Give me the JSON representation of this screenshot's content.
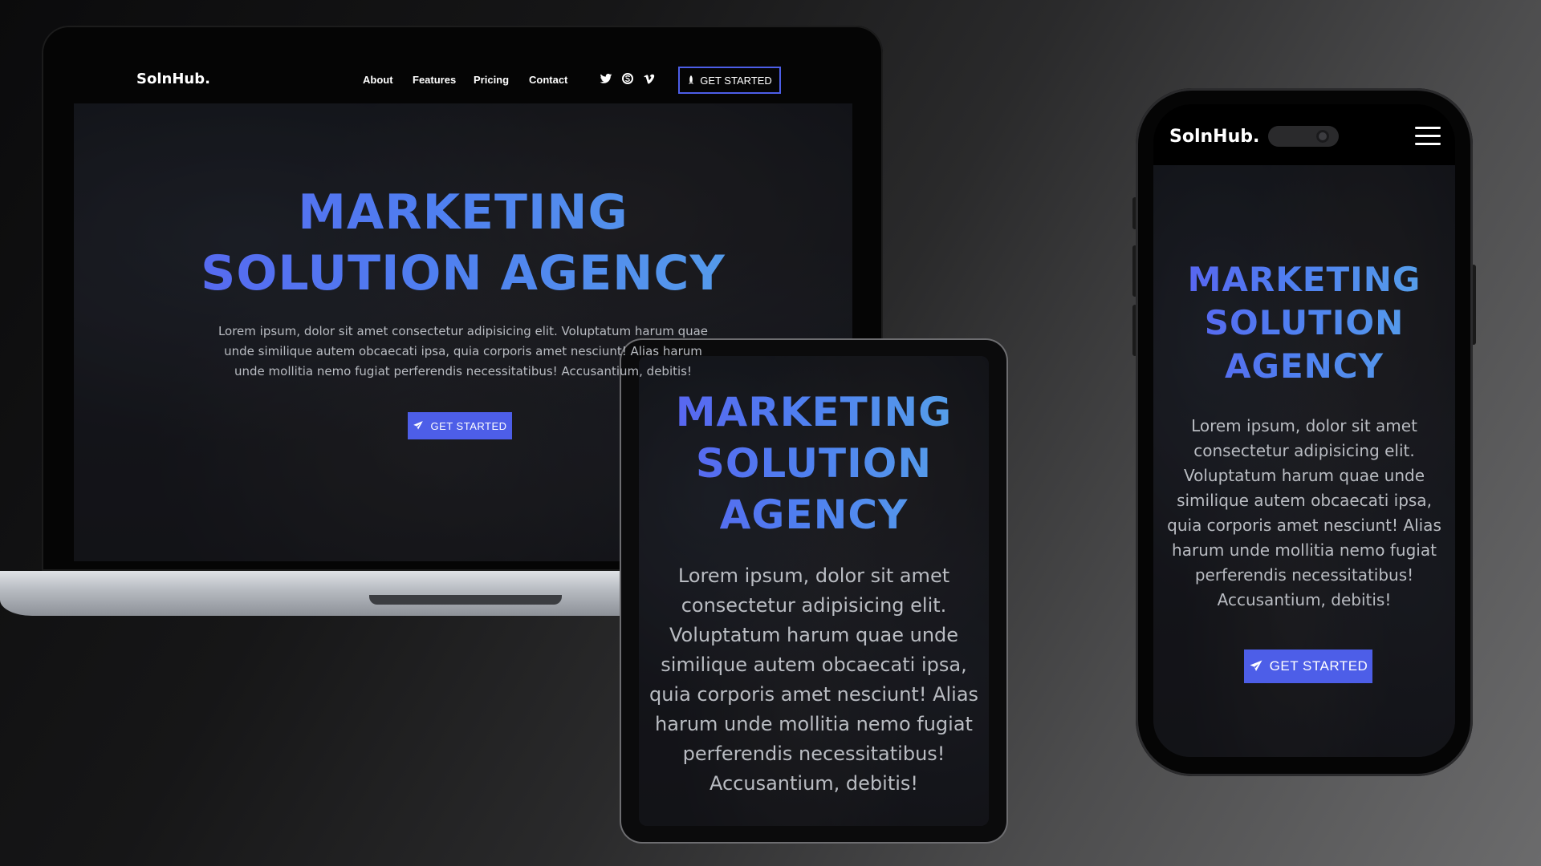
{
  "brand": "SolnHub.",
  "nav": {
    "links": [
      "About",
      "Features",
      "Pricing",
      "Contact"
    ],
    "cta_label": "GET STARTED"
  },
  "social_icons": [
    "twitter-icon",
    "skype-icon",
    "vimeo-icon"
  ],
  "hero": {
    "title_line1": "MARKETING",
    "title_line2": "SOLUTION AGENCY",
    "title_word1": "MARKETING",
    "title_word2": "SOLUTION",
    "title_word3": "AGENCY",
    "body_laptop_1": "Lorem ipsum, dolor sit amet consectetur adipisicing elit. Voluptatum harum quae",
    "body_laptop_2": "unde similique autem obcaecati ipsa, quia corporis amet nesciunt! Alias harum",
    "body_laptop_3": "unde mollitia nemo fugiat perferendis necessitatibus! Accusantium, debitis!",
    "body_tablet": [
      "Lorem ipsum, dolor sit amet",
      "consectetur adipisicing elit.",
      "Voluptatum harum quae unde",
      "similique autem obcaecati ipsa,",
      "quia corporis amet nesciunt! Alias",
      "harum unde mollitia nemo fugiat",
      "perferendis necessitatibus!",
      "Accusantium, debitis!"
    ],
    "body_phone": [
      "Lorem ipsum, dolor sit amet",
      "consectetur adipisicing elit.",
      "Voluptatum harum quae unde",
      "similique autem obcaecati ipsa,",
      "quia corporis amet nesciunt! Alias",
      "harum unde mollitia nemo fugiat",
      "perferendis necessitatibus!",
      "Accusantium, debitis!"
    ],
    "cta_label": "GET STARTED"
  },
  "colors": {
    "accent": "#4d5ee8",
    "gradient_start": "#5b5ff0",
    "gradient_end": "#57a6e8"
  }
}
